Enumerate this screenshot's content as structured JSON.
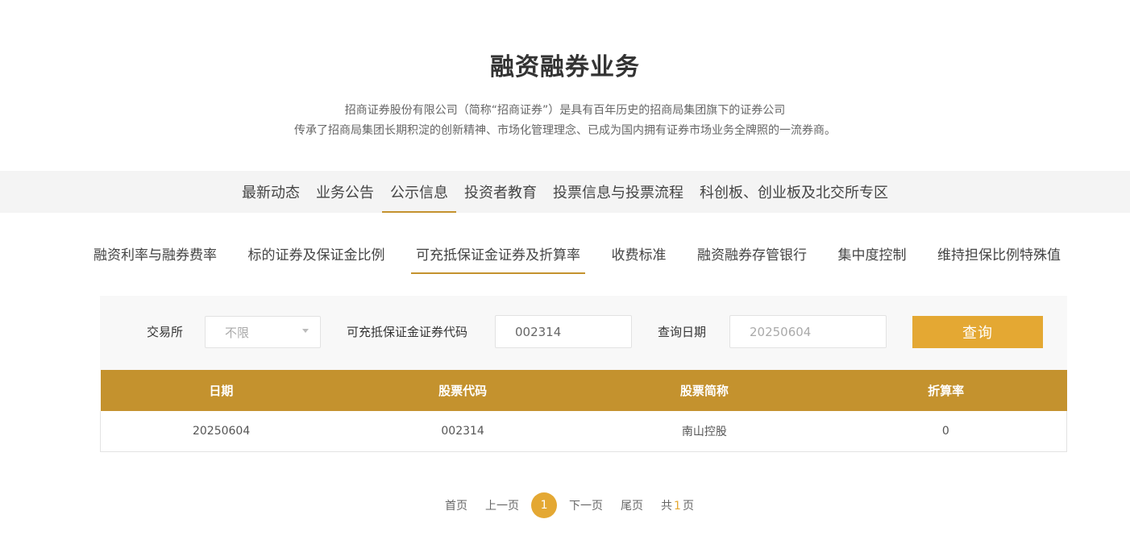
{
  "header": {
    "title": "融资融券业务",
    "intro_line1": "招商证券股份有限公司（简称“招商证券”）是具有百年历史的招商局集团旗下的证券公司",
    "intro_line2": "传承了招商局集团长期积淀的创新精神、市场化管理理念、已成为国内拥有证券市场业务全牌照的一流券商。"
  },
  "main_nav": {
    "items": [
      {
        "label": "最新动态"
      },
      {
        "label": "业务公告"
      },
      {
        "label": "公示信息",
        "active": true
      },
      {
        "label": "投资者教育"
      },
      {
        "label": "投票信息与投票流程"
      },
      {
        "label": "科创板、创业板及北交所专区"
      }
    ]
  },
  "sub_nav": {
    "items": [
      {
        "label": "融资利率与融券费率"
      },
      {
        "label": "标的证券及保证金比例"
      },
      {
        "label": "可充抵保证金证券及折算率",
        "active": true
      },
      {
        "label": "收费标准"
      },
      {
        "label": "融资融券存管银行"
      },
      {
        "label": "集中度控制"
      },
      {
        "label": "维持担保比例特殊值"
      }
    ]
  },
  "filter": {
    "exchange_label": "交易所",
    "exchange_value": "不限",
    "code_label": "可充抵保证金证券代码",
    "code_value": "002314",
    "date_label": "查询日期",
    "date_placeholder": "20250604",
    "query_button": "查询"
  },
  "table": {
    "headers": [
      "日期",
      "股票代码",
      "股票简称",
      "折算率"
    ],
    "rows": [
      [
        "20250604",
        "002314",
        "南山控股",
        "0"
      ]
    ]
  },
  "pagination": {
    "first": "首页",
    "prev": "上一页",
    "current": "1",
    "next": "下一页",
    "last": "尾页",
    "total_prefix": "共",
    "total_pages": "1",
    "total_suffix": "页"
  },
  "colors": {
    "accent": "#e4a833",
    "table_header": "#c4922e",
    "nav_background": "#f4f4f4",
    "filter_background": "#f8f8f8"
  }
}
